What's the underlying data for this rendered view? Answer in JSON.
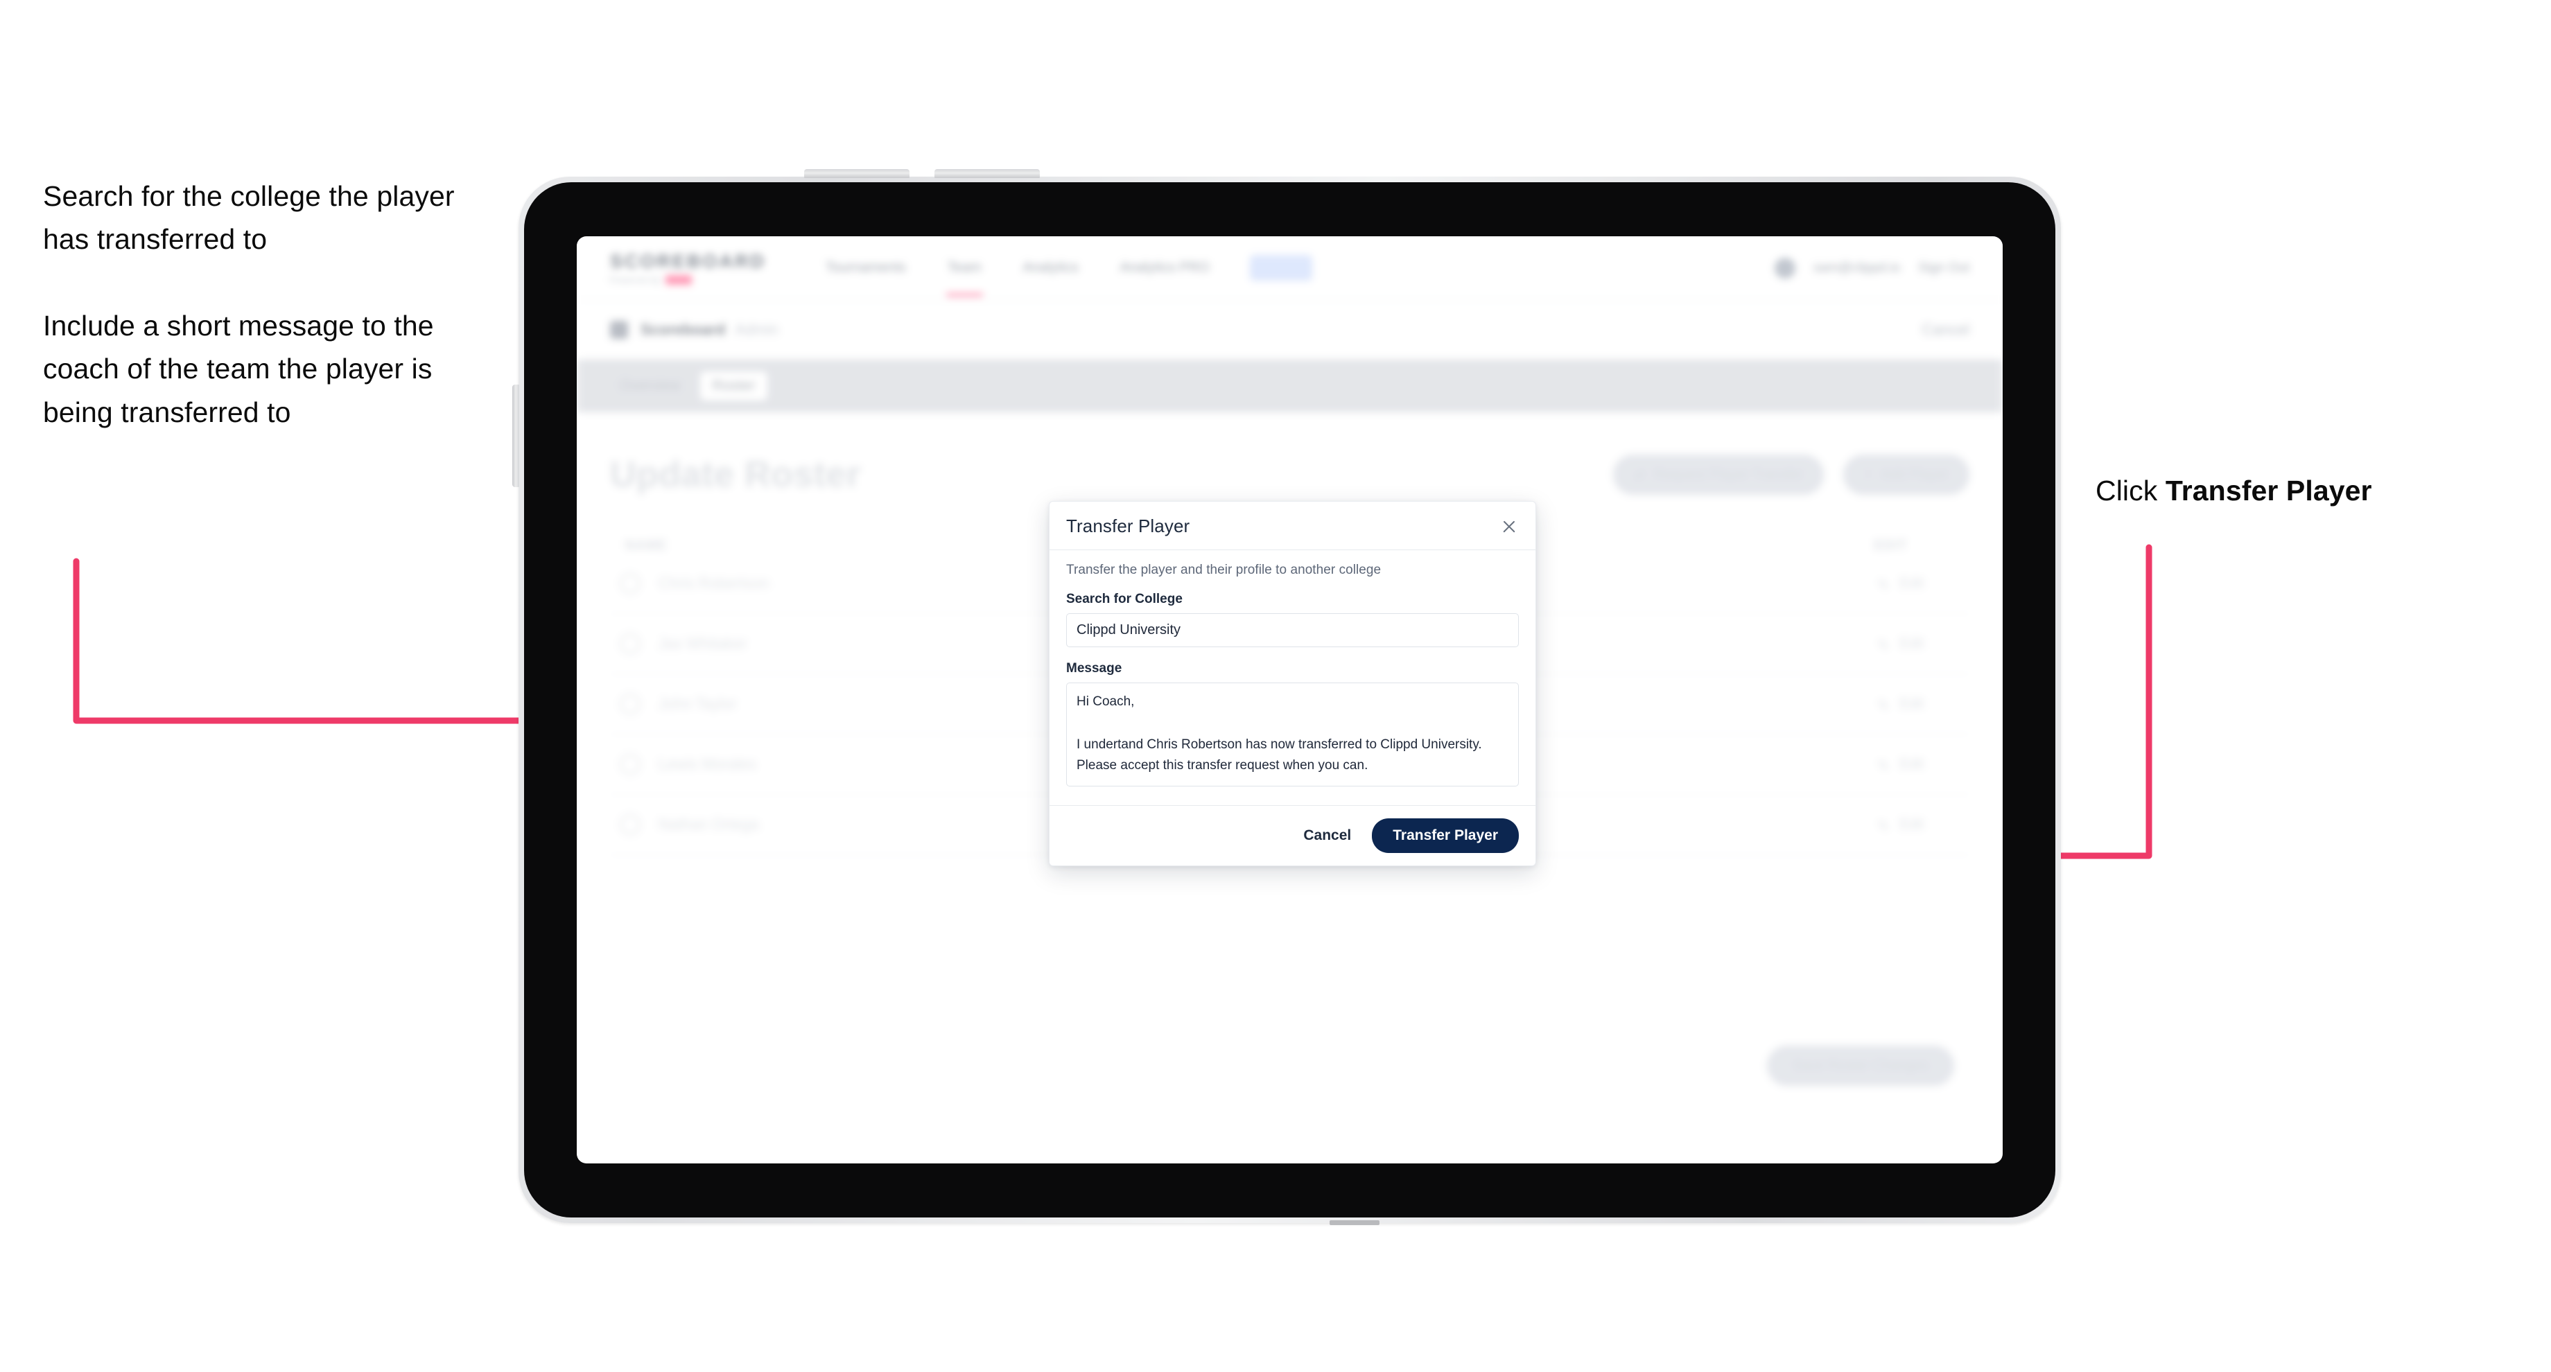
{
  "annotations": {
    "left": [
      "Search for the college the player has transferred to",
      "Include a short message to the coach of the team the player is being transferred to"
    ],
    "right": {
      "prefix": "Click ",
      "bold": "Transfer Player"
    }
  },
  "arrows": {
    "color": "#ee3a68",
    "left_arrow_name": "arrow-to-search-field",
    "right_arrow_name": "arrow-to-transfer-player-button"
  },
  "app": {
    "brand": {
      "name": "SCOREBOARD",
      "sub": "Powered by",
      "mark": "clippd"
    },
    "nav_links": [
      {
        "label": "Tournaments",
        "active": false
      },
      {
        "label": "Team",
        "active": true
      },
      {
        "label": "Analytics",
        "active": false
      },
      {
        "label": "Analytics PRO",
        "active": false
      }
    ],
    "nav_pill": "Roster",
    "nav_right": {
      "email": "sam@clippd.io",
      "sign_out": "Sign Out"
    },
    "breadcrumb": {
      "main": "Scoreboard",
      "sub": "Admin",
      "right": "Cancel"
    },
    "tabs": [
      {
        "label": "Overview",
        "active": false
      },
      {
        "label": "Roster",
        "active": true
      }
    ],
    "page_title": "Update Roster",
    "title_actions": [
      {
        "label": "Request Player Transfer",
        "icon": "transfer-icon"
      },
      {
        "label": "Add Player",
        "icon": "plus-icon"
      }
    ],
    "roster_columns": {
      "name": "NAME",
      "edit": "EDIT"
    },
    "roster_rows": [
      {
        "name": "Chris Robertson",
        "edit": "Edit"
      },
      {
        "name": "Jax Whitaker",
        "edit": "Edit"
      },
      {
        "name": "John Taylor",
        "edit": "Edit"
      },
      {
        "name": "Lewis Morales",
        "edit": "Edit"
      },
      {
        "name": "Nathan Ortega",
        "edit": "Edit"
      }
    ],
    "bottom_cta": "Save Roster Changes"
  },
  "modal": {
    "title": "Transfer Player",
    "close_icon": "close-icon",
    "description": "Transfer the player and their profile to another college",
    "search_label": "Search for College",
    "search_value": "Clippd University",
    "search_placeholder": "Search for College",
    "message_label": "Message",
    "message_value": "Hi Coach,\n\nI undertand Chris Robertson has now transferred to Clippd University. Please accept this transfer request when you can.",
    "message_placeholder": "Message",
    "cancel_label": "Cancel",
    "submit_label": "Transfer Player",
    "submit_color": "#0c2650"
  }
}
